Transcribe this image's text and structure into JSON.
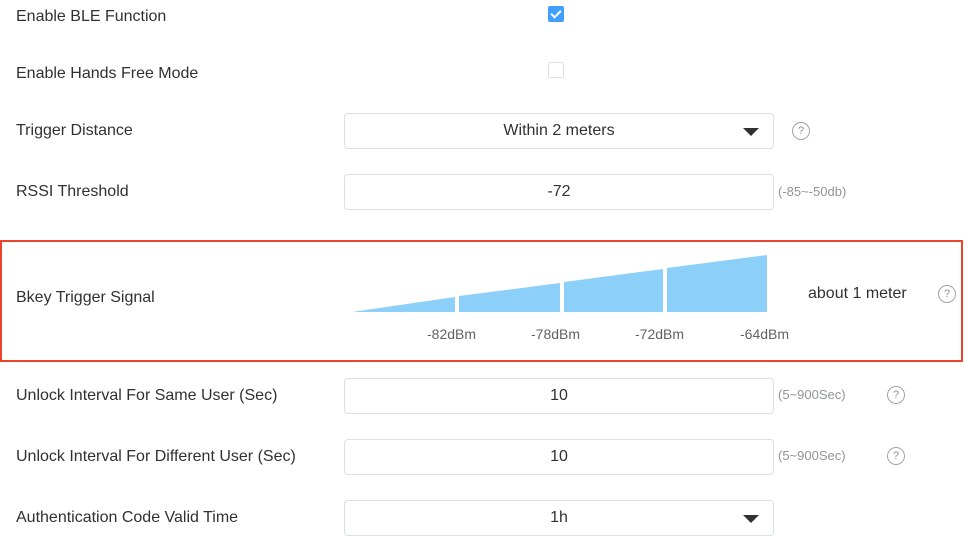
{
  "ble": {
    "enable_label": "Enable BLE Function",
    "enable_checked": true,
    "hands_free_label": "Enable Hands Free Mode",
    "hands_free_checked": false,
    "trigger_distance_label": "Trigger Distance",
    "trigger_distance_value": "Within 2 meters",
    "rssi_label": "RSSI Threshold",
    "rssi_value": "-72",
    "rssi_range": "(-85~-50db)",
    "bkey_label": "Bkey Trigger Signal",
    "bkey_result": "about 1 meter",
    "signal_levels": [
      "-82dBm",
      "-78dBm",
      "-72dBm",
      "-64dBm"
    ],
    "signal_color": "#8ccff8",
    "unlock_same_label": "Unlock Interval For Same User (Sec)",
    "unlock_same_value": "10",
    "unlock_same_range": "(5~900Sec)",
    "unlock_diff_label": "Unlock Interval For Different User (Sec)",
    "unlock_diff_value": "10",
    "unlock_diff_range": "(5~900Sec)",
    "auth_label": "Authentication Code Valid Time",
    "auth_value": "1h"
  },
  "help_glyph": "?",
  "highlight_color": "#e8452c",
  "accent_color": "#409eff"
}
